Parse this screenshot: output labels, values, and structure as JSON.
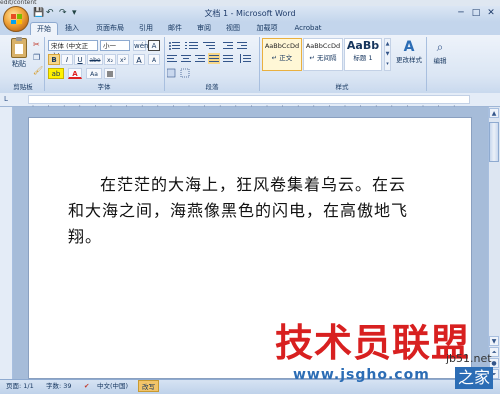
{
  "url_strip": "edit/content",
  "window": {
    "title": "文档 1 - Microsoft Word",
    "min_glyph": "─",
    "max_glyph": "□",
    "close_glyph": "✕"
  },
  "quick_access": {
    "save": "💾",
    "undo": "↶",
    "redo": "↷",
    "more": "▾"
  },
  "tabs": [
    "开始",
    "插入",
    "页面布局",
    "引用",
    "邮件",
    "审阅",
    "视图",
    "加载项",
    "Acrobat"
  ],
  "active_tab": "开始",
  "ribbon": {
    "clipboard": {
      "paste_label": "粘贴",
      "group_label": "剪贴板"
    },
    "font": {
      "font_name": "宋体 (中文正文)",
      "font_size": "小一",
      "bold": "B",
      "italic": "I",
      "underline": "U",
      "strike": "abe",
      "sub": "x₂",
      "sup": "x²",
      "clear": "Aa",
      "grow": "A",
      "shrink": "A",
      "pinyin": "wén",
      "border_char": "A",
      "highlight": "ab",
      "font_color": "A",
      "group_label": "字体"
    },
    "paragraph": {
      "group_label": "段落"
    },
    "styles": {
      "items": [
        {
          "preview": "AaBbCcDd",
          "name": "↵ 正文"
        },
        {
          "preview": "AaBbCcDd",
          "name": "↵ 无间隔"
        },
        {
          "preview": "AaBb",
          "name": "标题 1"
        }
      ],
      "change_styles": "更改样式",
      "group_label": "样式"
    },
    "editing": {
      "label": "编辑"
    }
  },
  "document": {
    "paragraph": "在茫茫的大海上，狂风卷集着乌云。在云和大海之间，海燕像黑色的闪电，在高傲地飞翔。"
  },
  "statusbar": {
    "page": "页面: 1/1",
    "words": "字数: 39",
    "language": "中文(中国)",
    "mode": "改写"
  },
  "watermark": {
    "main": "技术员联盟",
    "url": "www.jsgho.com",
    "side": "jb51.net",
    "home": "之家"
  },
  "colors": {
    "accent": "#c3d5ec",
    "highlight_yellow": "#fff200",
    "font_red": "#e02020",
    "watermark_red": "#d82020"
  }
}
